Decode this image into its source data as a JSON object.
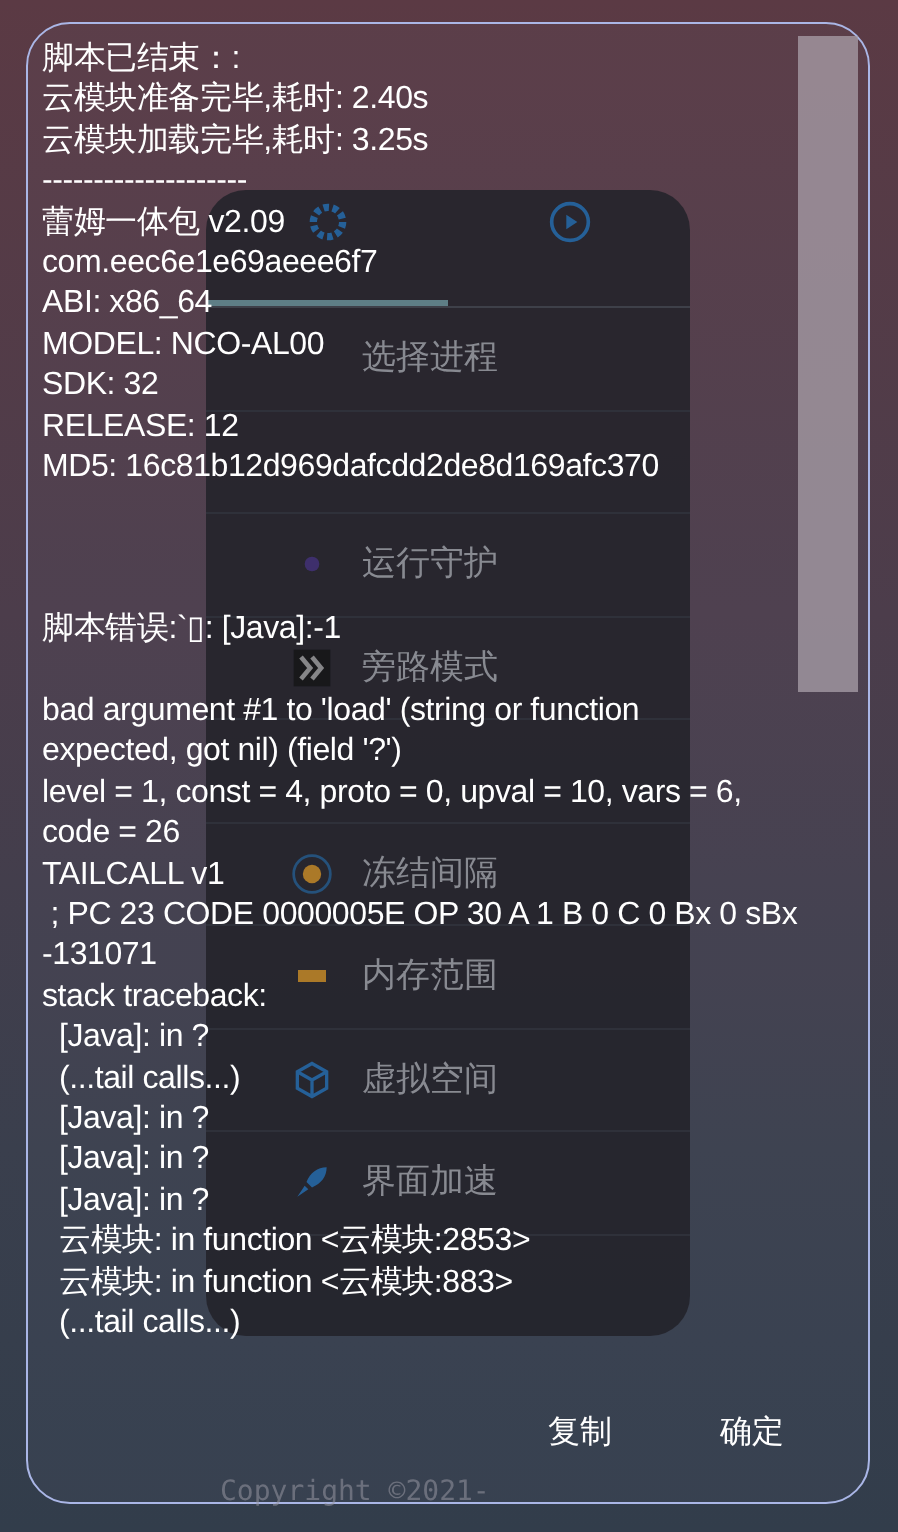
{
  "menu": {
    "tabs": [
      {
        "selected": true
      },
      {
        "selected": false
      }
    ],
    "items": [
      {
        "kind": "label",
        "label": "选择进程"
      },
      {
        "kind": "empty"
      },
      {
        "kind": "full",
        "label": "运行守护"
      },
      {
        "kind": "full",
        "label": "旁路模式"
      },
      {
        "kind": "empty"
      },
      {
        "kind": "full",
        "label": "冻结间隔"
      },
      {
        "kind": "full",
        "label": "内存范围"
      },
      {
        "kind": "full",
        "label": "虚拟空间"
      },
      {
        "kind": "full",
        "label": "界面加速"
      }
    ]
  },
  "dialog": {
    "log_lines": [
      {
        "kind": "text",
        "text": "脚本已结束：:"
      },
      {
        "kind": "text",
        "text": "云模块准备完毕,耗时: 2.40s"
      },
      {
        "kind": "text",
        "text": "云模块加载完毕,耗时: 3.25s"
      },
      {
        "kind": "text",
        "text": "--------------------"
      },
      {
        "kind": "text",
        "text": "蕾姆一体包 v2.09"
      },
      {
        "kind": "text",
        "text": "com.eec6e1e69aeee6f7"
      },
      {
        "kind": "text",
        "text": "ABI: x86_64"
      },
      {
        "kind": "text",
        "text": "MODEL: NCO-AL00"
      },
      {
        "kind": "text",
        "text": "SDK: 32"
      },
      {
        "kind": "text",
        "text": "RELEASE: 12"
      },
      {
        "kind": "text",
        "text": "MD5: 16c81b12d969dafcdd2de8d169afc370"
      },
      {
        "kind": "gap"
      },
      {
        "kind": "text",
        "text": "脚本错误:`▯: [Java]:-1"
      },
      {
        "kind": "blank"
      },
      {
        "kind": "text",
        "text": "bad argument #1 to 'load' (string or function"
      },
      {
        "kind": "text",
        "text": "expected, got nil) (field '?')"
      },
      {
        "kind": "text",
        "text": "level = 1, const = 4, proto = 0, upval = 10, vars = 6,"
      },
      {
        "kind": "text",
        "text": "code = 26"
      },
      {
        "kind": "text",
        "text": "TAILCALL v1"
      },
      {
        "kind": "text",
        "text": " ; PC 23 CODE 0000005E OP 30 A 1 B 0 C 0 Bx 0 sBx"
      },
      {
        "kind": "text",
        "text": "-131071"
      },
      {
        "kind": "text",
        "text": "stack traceback:"
      },
      {
        "kind": "text",
        "text": "  [Java]: in ?"
      },
      {
        "kind": "text",
        "text": "  (...tail calls...)"
      },
      {
        "kind": "text",
        "text": "  [Java]: in ?"
      },
      {
        "kind": "text",
        "text": "  [Java]: in ?"
      },
      {
        "kind": "text",
        "text": "  [Java]: in ?"
      },
      {
        "kind": "text",
        "text": "  云模块: in function <云模块:2853>"
      },
      {
        "kind": "text",
        "text": "  云模块: in function <云模块:883>"
      },
      {
        "kind": "text",
        "text": "  (...tail calls...)"
      }
    ],
    "buttons": [
      "复制",
      "确定"
    ]
  },
  "footer": "Copyright ©2021-"
}
